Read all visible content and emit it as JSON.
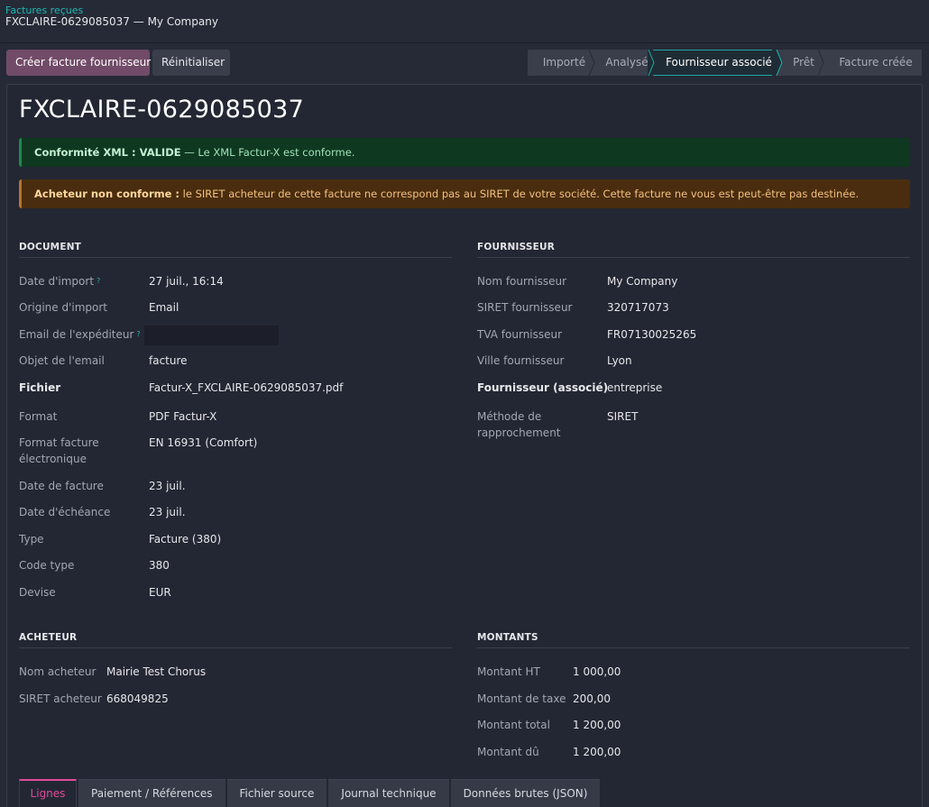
{
  "breadcrumb": {
    "parent": "Factures reçues",
    "current": "FXCLAIRE-0629085037 — My Company"
  },
  "actions": {
    "primary": "Créer facture fournisseur",
    "secondary": "Réinitialiser"
  },
  "status_steps": [
    "Importé",
    "Analysé",
    "Fournisseur associé",
    "Prêt",
    "Facture créée"
  ],
  "active_step": "Fournisseur associé",
  "title": "FXCLAIRE-0629085037",
  "alerts": {
    "success": {
      "bold": "Conformité XML : VALIDE",
      "text": " — Le XML Factur-X est conforme."
    },
    "warning": {
      "bold": "Acheteur non conforme :",
      "text": " le SIRET acheteur de cette facture ne correspond pas au SIRET de votre société. Cette facture ne vous est peut-être pas destinée."
    }
  },
  "document": {
    "heading": "DOCUMENT",
    "fields": [
      {
        "label": "Date d'import",
        "help": "?",
        "value": "27 juil., 16:14"
      },
      {
        "label": "Origine d'import",
        "value": "Email"
      },
      {
        "label": "Email de l'expéditeur",
        "help": "?",
        "value": ""
      },
      {
        "label": "Objet de l'email",
        "value": "facture"
      },
      {
        "label": "Fichier",
        "value": "Factur-X_FXCLAIRE-0629085037.pdf"
      },
      {
        "label": "Format",
        "value": "PDF Factur-X"
      },
      {
        "label": "Format facture électronique",
        "value": "EN 16931 (Comfort)"
      },
      {
        "label": "Date de facture",
        "value": "23 juil."
      },
      {
        "label": "Date d'échéance",
        "value": "23 juil."
      },
      {
        "label": "Type",
        "value": "Facture (380)"
      },
      {
        "label": "Code type",
        "value": "380"
      },
      {
        "label": "Devise",
        "value": "EUR"
      }
    ]
  },
  "fournisseur": {
    "heading": "FOURNISSEUR",
    "fields": [
      {
        "label": "Nom fournisseur",
        "value": "My Company"
      },
      {
        "label": "SIRET fournisseur",
        "value": "320717073"
      },
      {
        "label": "TVA fournisseur",
        "value": "FR07130025265"
      },
      {
        "label": "Ville fournisseur",
        "value": "Lyon"
      },
      {
        "label": "Fournisseur (associé)",
        "value": "entreprise"
      },
      {
        "label": "Méthode de rapprochement",
        "value": "SIRET"
      }
    ]
  },
  "acheteur": {
    "heading": "ACHETEUR",
    "fields": [
      {
        "label": "Nom acheteur",
        "value": "Mairie Test Chorus"
      },
      {
        "label": "SIRET acheteur",
        "value": "668049825"
      }
    ]
  },
  "montants": {
    "heading": "MONTANTS",
    "fields": [
      {
        "label": "Montant HT",
        "value": "1 000,00"
      },
      {
        "label": "Montant de taxe",
        "value": "200,00"
      },
      {
        "label": "Montant total",
        "value": "1 200,00"
      },
      {
        "label": "Montant dû",
        "value": "1 200,00"
      }
    ]
  },
  "tabs": [
    "Lignes",
    "Paiement / Références",
    "Fichier source",
    "Journal technique",
    "Données brutes (JSON)"
  ],
  "colors": {
    "accent": "#1fb7b4",
    "primary": "#714b67",
    "tab_active": "#e04a9a",
    "success_bg": "#0f3821",
    "warning_bg": "#4a2d0e"
  }
}
